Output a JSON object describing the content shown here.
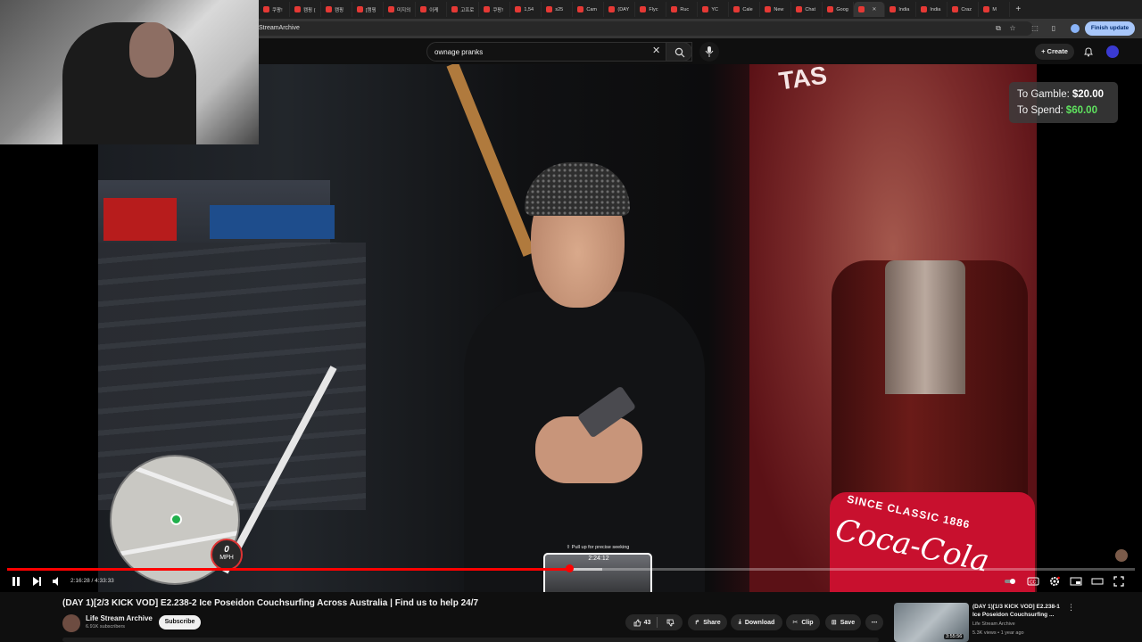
{
  "browser": {
    "tabs": [
      {
        "label": "쿠팡!"
      },
      {
        "label": "캠핑 ("
      },
      {
        "label": "캠핑"
      },
      {
        "label": "[캠핑"
      },
      {
        "label": "미지의"
      },
      {
        "label": "이케"
      },
      {
        "label": "고프로"
      },
      {
        "label": "쿠팡!"
      },
      {
        "label": "1,54"
      },
      {
        "label": "s25"
      },
      {
        "label": "Cam"
      },
      {
        "label": "(DAY"
      },
      {
        "label": "Flyc"
      },
      {
        "label": "Ruc"
      },
      {
        "label": "YC"
      },
      {
        "label": "Cale"
      },
      {
        "label": "New"
      },
      {
        "label": "Chat"
      },
      {
        "label": "Goog"
      },
      {
        "label": ""
      },
      {
        "label": "India"
      },
      {
        "label": "India"
      },
      {
        "label": "Craz"
      },
      {
        "label": "M"
      }
    ],
    "new_tab": "+",
    "url": "StreamArchive",
    "finish_update": "Finish update"
  },
  "yt_header": {
    "search_value": "ownage pranks",
    "create_label": "Create"
  },
  "overlay": {
    "gamble_label": "To Gamble:",
    "gamble_value": "$20.00",
    "spend_label": "To Spend:",
    "spend_value": "$60.00",
    "speed_value": "0",
    "speed_unit": "MPH",
    "cooler_text": "TAS",
    "label_classic": "SINCE CLASSIC 1886",
    "label_brand": "Coca-Cola"
  },
  "player": {
    "seek_hint": "⇧ Pull up for precise seeking",
    "seek_time": "2:24:12",
    "current_time": "2:16:28",
    "duration": "4:33:33",
    "time_separator": " / ",
    "progress": 0.499,
    "hover_progress": 0.528
  },
  "video": {
    "title": "(DAY 1)[2/3 KICK VOD] E2.238-2 Ice Poseidon Couchsurfing Across Australia | Find us to help 24/7",
    "channel": "Life Stream Archive",
    "subscribers": "6.91K subscribers",
    "subscribe_label": "Subscribe",
    "likes": "43",
    "share_label": "Share",
    "download_label": "Download",
    "clip_label": "Clip",
    "save_label": "Save"
  },
  "recommendation": {
    "title": "(DAY 1)[1/3 KICK VOD] E2.238-1 Ice Poseidon Couchsurfing ...",
    "channel": "Life Stream Archive",
    "meta": "5.3K views • 1 year ago",
    "duration": "3:55:56"
  },
  "colors": {
    "accent": "#ff0000",
    "spend_green": "#5fe35f",
    "finish_update_bg": "#a8c7fa"
  }
}
